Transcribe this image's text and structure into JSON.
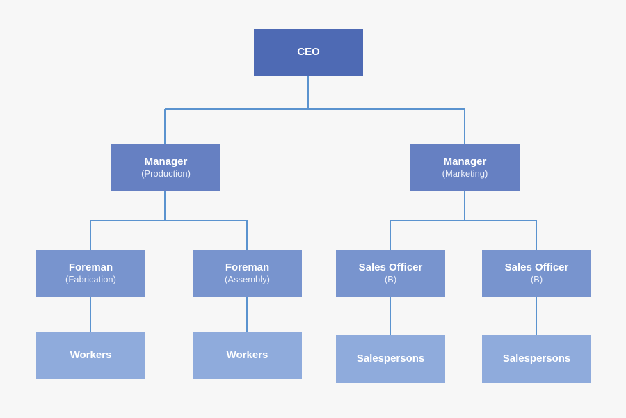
{
  "diagram": {
    "type": "org-chart",
    "line_color": "#5b93cf",
    "nodes": {
      "ceo": {
        "title": "CEO"
      },
      "manager_production": {
        "title": "Manager",
        "subtitle": "(Production)"
      },
      "manager_marketing": {
        "title": "Manager",
        "subtitle": "(Marketing)"
      },
      "foreman_fabrication": {
        "title": "Foreman",
        "subtitle": "(Fabrication)"
      },
      "foreman_assembly": {
        "title": "Foreman",
        "subtitle": "(Assembly)"
      },
      "sales_officer_1": {
        "title": "Sales Officer",
        "subtitle": "(B)"
      },
      "sales_officer_2": {
        "title": "Sales Officer",
        "subtitle": "(B)"
      },
      "workers_1": {
        "title": "Workers"
      },
      "workers_2": {
        "title": "Workers"
      },
      "salespersons_1": {
        "title": "Salespersons"
      },
      "salespersons_2": {
        "title": "Salespersons"
      }
    },
    "edges": [
      [
        "ceo",
        "manager_production"
      ],
      [
        "ceo",
        "manager_marketing"
      ],
      [
        "manager_production",
        "foreman_fabrication"
      ],
      [
        "manager_production",
        "foreman_assembly"
      ],
      [
        "manager_marketing",
        "sales_officer_1"
      ],
      [
        "manager_marketing",
        "sales_officer_2"
      ],
      [
        "foreman_fabrication",
        "workers_1"
      ],
      [
        "foreman_assembly",
        "workers_2"
      ],
      [
        "sales_officer_1",
        "salespersons_1"
      ],
      [
        "sales_officer_2",
        "salespersons_2"
      ]
    ]
  }
}
